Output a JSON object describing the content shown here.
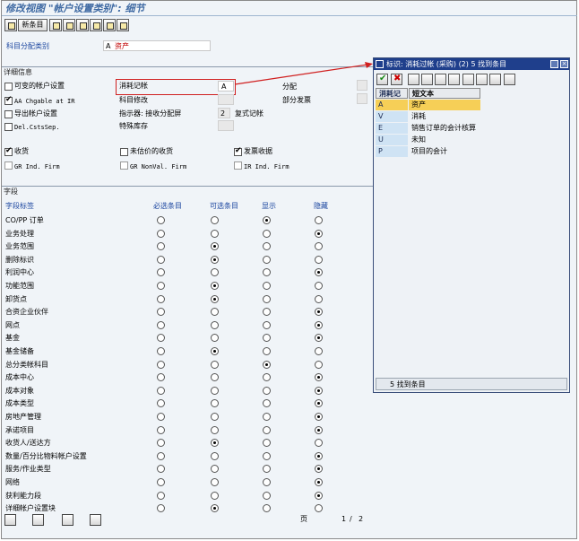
{
  "window": {
    "title": "修改视图 \"帐户设置类别\": 细节"
  },
  "toolbar": {
    "new_entry_label": "新条目"
  },
  "account_category": {
    "label": "科目分配类别",
    "code": "A",
    "value": "资产"
  },
  "detail_section": {
    "title": "详细信息",
    "checks": [
      {
        "label": "可变的帐户设置",
        "checked": false
      },
      {
        "label": "AA Chgable at IR",
        "checked": true
      },
      {
        "label": "导出帐户设置",
        "checked": false
      },
      {
        "label": "Del.CstsSep.",
        "checked": false
      }
    ],
    "consumption_posting": {
      "label": "消耗记帐",
      "value": "A"
    },
    "acct_modification_label": "科目修改",
    "gr_indicator": {
      "label": "指示器: 接收分配屏",
      "value": "2"
    },
    "special_stock_label": "特殊库存",
    "distribution_label": "分配",
    "partial_invoice_label": "部分发票",
    "posting_label": "复式记帐",
    "checks2": [
      {
        "label": "收货",
        "checked": true
      },
      {
        "label": "GR Ind. Firm",
        "checked": false
      },
      {
        "label": "未估价的收货",
        "checked": false
      },
      {
        "label": "GR NonVal. Firm",
        "checked": false
      },
      {
        "label": "发票收据",
        "checked": true
      },
      {
        "label": "IR Ind. Firm",
        "checked": false
      }
    ]
  },
  "fields_section": {
    "title": "字段",
    "columns": [
      "字段标签",
      "必选条目",
      "可选条目",
      "显示",
      "隐藏"
    ],
    "rows": [
      {
        "label": "CO/PP 订单",
        "sel": 2
      },
      {
        "label": "业务处理",
        "sel": 3
      },
      {
        "label": "业务范围",
        "sel": 1
      },
      {
        "label": "删除标识",
        "sel": 1
      },
      {
        "label": "利润中心",
        "sel": 3
      },
      {
        "label": "功能范围",
        "sel": 1
      },
      {
        "label": "卸货点",
        "sel": 1
      },
      {
        "label": "合资企业伙伴",
        "sel": 3
      },
      {
        "label": "网点",
        "sel": 3
      },
      {
        "label": "基金",
        "sel": 3
      },
      {
        "label": "基金储备",
        "sel": 1
      },
      {
        "label": "总分类帐科目",
        "sel": 2
      },
      {
        "label": "成本中心",
        "sel": 3
      },
      {
        "label": "成本对象",
        "sel": 3
      },
      {
        "label": "成本类型",
        "sel": 3
      },
      {
        "label": "房地产管理",
        "sel": 3
      },
      {
        "label": "承诺项目",
        "sel": 3
      },
      {
        "label": "收货人/送达方",
        "sel": 1
      },
      {
        "label": "数量/百分比物料帐户设置",
        "sel": 3
      },
      {
        "label": "服务/作业类型",
        "sel": 3
      },
      {
        "label": "网络",
        "sel": 3
      },
      {
        "label": "获利能力段",
        "sel": 3
      },
      {
        "label": "详细帐户设置块",
        "sel": 1
      }
    ],
    "pager": {
      "label": "页",
      "current": "1",
      "separator": "/",
      "total": "2"
    }
  },
  "popup": {
    "title": "标识: 消耗过帐 (采购) (2)   5 找到条目",
    "headers": [
      "消耗记",
      "短文本"
    ],
    "rows": [
      {
        "key": "A",
        "text": "资产",
        "selected": true
      },
      {
        "key": "V",
        "text": "消耗",
        "selected": false
      },
      {
        "key": "E",
        "text": "销售订单的会计核算",
        "selected": false
      },
      {
        "key": "U",
        "text": "未知",
        "selected": false
      },
      {
        "key": "P",
        "text": "项目的会计",
        "selected": false
      }
    ],
    "status": "5 找到条目"
  },
  "colors": {
    "title": "#3f6aa3",
    "selection": "#f6cf57",
    "popup_header": "#1f3f8c",
    "highlight_border": "#d02020"
  }
}
